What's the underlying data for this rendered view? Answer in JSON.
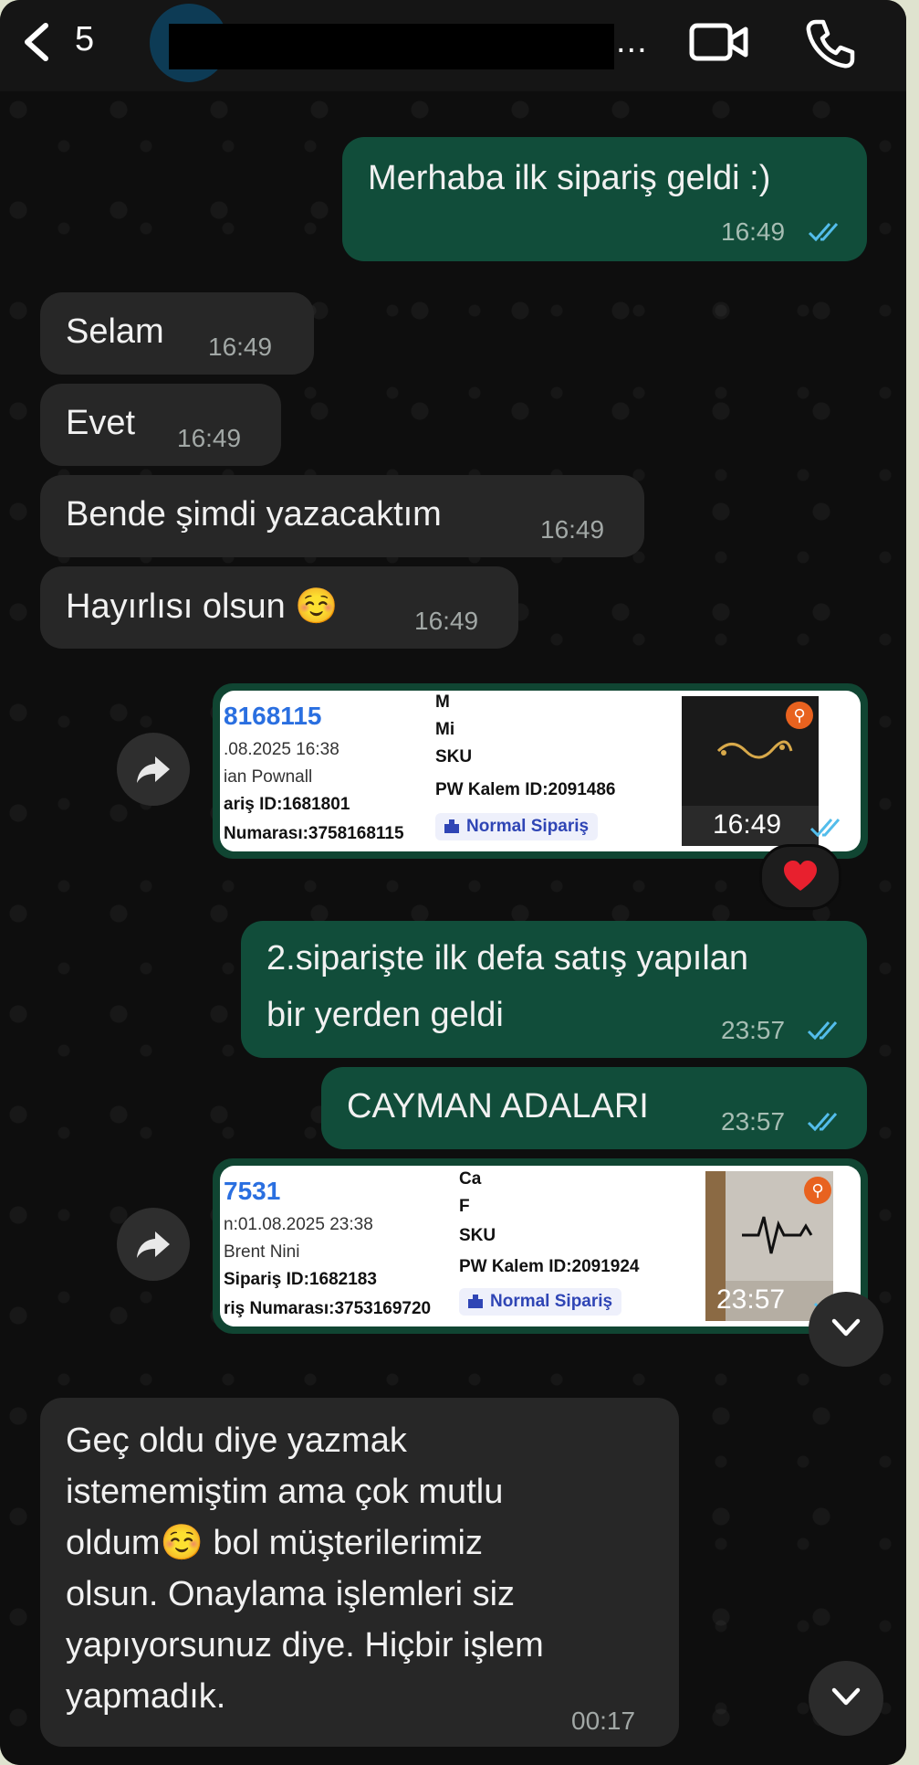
{
  "header": {
    "back_count": "5",
    "ellipsis": "..."
  },
  "messages": {
    "m1": {
      "text": "Merhaba ilk sipariş geldi :)",
      "time": "16:49"
    },
    "m2": {
      "text": "Selam",
      "time": "16:49"
    },
    "m3": {
      "text": "Evet",
      "time": "16:49"
    },
    "m4": {
      "text": "Bende şimdi yazacaktım",
      "time": "16:49"
    },
    "m5": {
      "text": "Hayırlısı olsun ☺️",
      "time": "16:49"
    },
    "card1": {
      "id": "8168115",
      "date": ".08.2025 16:38",
      "name": "ian Pownall",
      "order_id": "ariş ID:1681801",
      "order_no": "Numarası:3758168115",
      "col2_line1": "M",
      "col2_line2": "Mi",
      "col2_line3": "SKU",
      "kalem": "PW Kalem ID:2091486",
      "badge": "Normal Sipariş",
      "time": "16:49"
    },
    "reaction": "heart",
    "m6": {
      "line1": "2.siparişte ilk defa satış yapılan",
      "line2": "bir yerden geldi",
      "time": "23:57"
    },
    "m7": {
      "text": "CAYMAN ADALARI",
      "time": "23:57"
    },
    "card2": {
      "id": "7531",
      "date": "n:01.08.2025 23:38",
      "name": "Brent Nini",
      "order_id": "Sipariş ID:1682183",
      "order_no": "riş Numarası:3753169720",
      "col2_line1": "Ca",
      "col2_line2": "F",
      "col2_line3": "SKU",
      "kalem": "PW Kalem ID:2091924",
      "badge": "Normal Sipariş",
      "time": "23:57"
    },
    "m8": {
      "lines": [
        "Geç oldu diye yazmak",
        "istememiştim ama çok mutlu",
        "oldum☺️  bol müşterilerimiz",
        "olsun. Onaylama işlemleri siz",
        "yapıyorsunuz diye. Hiçbir işlem",
        "yapmadık."
      ],
      "time": "00:17"
    }
  },
  "colors": {
    "outgoing": "#114d3a",
    "incoming": "#272727",
    "ticks": "#53bdeb"
  }
}
